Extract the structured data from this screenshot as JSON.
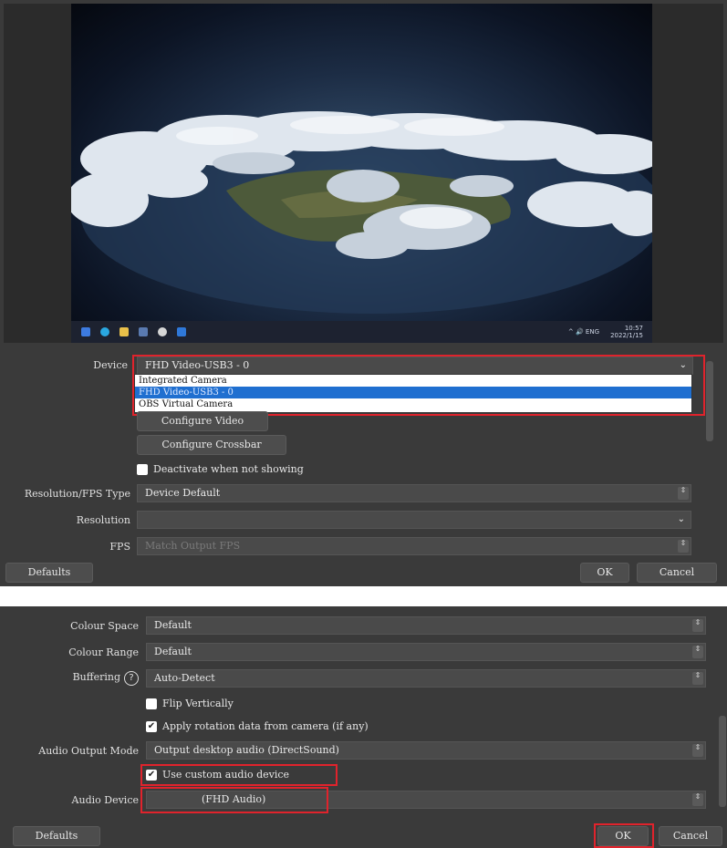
{
  "top_panel": {
    "taskbar": {
      "system_tray": "^ 🔊 ENG",
      "time": "10:57",
      "date": "2022/1/15"
    },
    "device": {
      "label": "Device",
      "value": "FHD Video-USB3 - 0",
      "options": [
        "Integrated Camera",
        "FHD Video-USB3 - 0",
        "OBS Virtual Camera"
      ],
      "selected_index": 1
    },
    "configure_video_label": "Configure Video",
    "configure_crossbar_label": "Configure Crossbar",
    "deactivate_label": "Deactivate when not showing",
    "deactivate_checked": false,
    "resolution_fps_type": {
      "label": "Resolution/FPS Type",
      "value": "Device Default"
    },
    "resolution": {
      "label": "Resolution",
      "value": ""
    },
    "fps": {
      "label": "FPS",
      "value": "Match Output FPS"
    },
    "defaults_label": "Defaults",
    "ok_label": "OK",
    "cancel_label": "Cancel"
  },
  "bottom_panel": {
    "colour_space": {
      "label": "Colour Space",
      "value": "Default"
    },
    "colour_range": {
      "label": "Colour Range",
      "value": "Default"
    },
    "buffering": {
      "label": "Buffering",
      "help_icon": "?",
      "value": "Auto-Detect"
    },
    "flip_vertically": {
      "label": "Flip Vertically",
      "checked": false
    },
    "apply_rotation": {
      "label": "Apply rotation data from camera (if any)",
      "checked": true
    },
    "audio_output_mode": {
      "label": "Audio Output Mode",
      "value": "Output desktop audio (DirectSound)"
    },
    "use_custom_audio": {
      "label": "Use custom audio device",
      "checked": true
    },
    "audio_device": {
      "label": "Audio Device",
      "value": "(FHD Audio)"
    },
    "defaults_label": "Defaults",
    "ok_label": "OK",
    "cancel_label": "Cancel"
  },
  "colors": {
    "panel_bg": "#3a3a3a",
    "field_bg": "#4a4a4a",
    "highlight_red": "#e0232c",
    "selection_blue": "#1f6fd0"
  },
  "icons": {
    "check": "✔",
    "spin": "⇕",
    "chevron": "⌄"
  }
}
